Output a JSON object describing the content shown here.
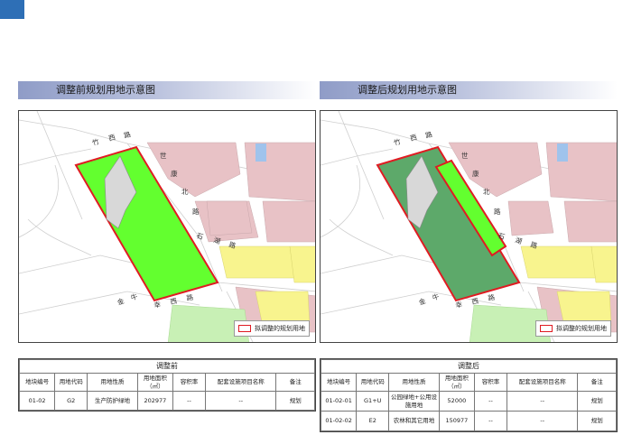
{
  "left": {
    "header": "调整前规划用地示意图",
    "legend": "拟调整的规划用地",
    "table": {
      "title": "调整前",
      "headers": [
        "地块编号",
        "用地代码",
        "用地性质",
        "用地面积（㎡）",
        "容积率",
        "配套设施项目名称",
        "备注"
      ],
      "rows": [
        [
          "01-02",
          "G2",
          "生产防护绿地",
          "202977",
          "--",
          "--",
          "规划"
        ]
      ]
    }
  },
  "right": {
    "header": "调整后规划用地示意图",
    "legend": "拟调整的规划用地",
    "table": {
      "title": "调整后",
      "headers": [
        "地块编号",
        "用地代码",
        "用地性质",
        "用地面积（㎡）",
        "容积率",
        "配套设施项目名称",
        "备注"
      ],
      "rows": [
        [
          "01-02-01",
          "G1+U",
          "公园绿地+公用设施用地",
          "52000",
          "--",
          "--",
          "规划"
        ],
        [
          "01-02-02",
          "E2",
          "农林和其它用地",
          "150977",
          "--",
          "--",
          "规划"
        ]
      ]
    }
  },
  "colors": {
    "residential": "#e8c2c6",
    "commercial_yellow": "#f8f48e",
    "green": "#63ff2f",
    "dark_green": "#5da96a",
    "light_green": "#c8f0b5",
    "blue": "#9fc3ec",
    "red": "#e01b22",
    "header_blue": "#8f9cc7"
  }
}
